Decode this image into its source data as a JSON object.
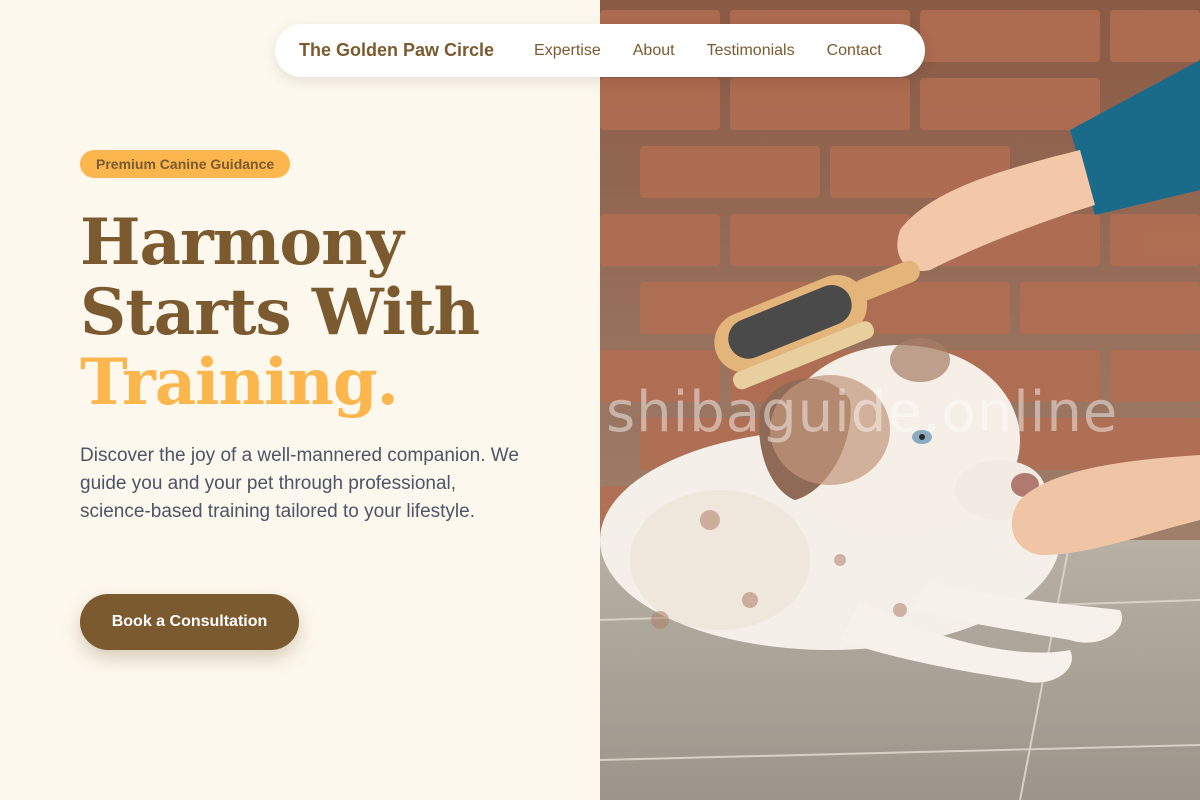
{
  "nav": {
    "brand": "The Golden Paw Circle",
    "links": [
      "Expertise",
      "About",
      "Testimonials",
      "Contact"
    ]
  },
  "hero": {
    "badge": "Premium Canine Guidance",
    "headline_line1": "Harmony",
    "headline_line2": "Starts With",
    "headline_accent": "Training.",
    "description": "Discover the joy of a well-mannered companion. We guide you and your pet through professional, science-based training tailored to your lifestyle.",
    "cta_label": "Book a Consultation"
  },
  "image": {
    "watermark": "shibaguide.online",
    "subject": "puppy-being-brushed"
  },
  "colors": {
    "brand_brown": "#7b5a2f",
    "accent_gold": "#fbb74e",
    "background_cream": "#fdf8ee",
    "body_text": "#4b5566"
  }
}
